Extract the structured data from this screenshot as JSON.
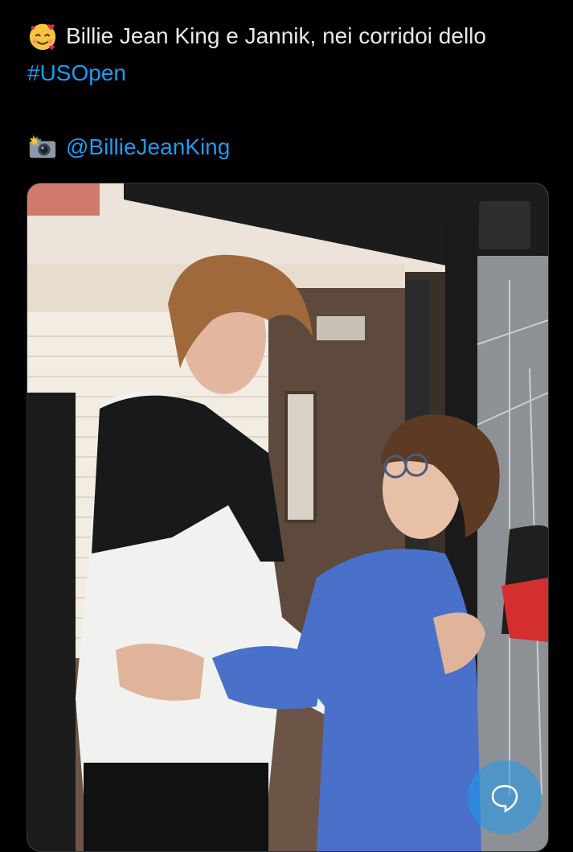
{
  "tweet": {
    "line1_text": "Billie Jean King e Jannik, nei corridoi dello",
    "hashtag": "#USOpen",
    "mention": "@BillieJeanKing",
    "line1_emoji": "smiling-face-with-hearts-emoji",
    "credit_emoji": "camera-with-flash-emoji"
  },
  "media": {
    "icon": "photo",
    "accent": "#1d9bf0"
  },
  "fab": {
    "icon": "reply-bubble-icon"
  }
}
